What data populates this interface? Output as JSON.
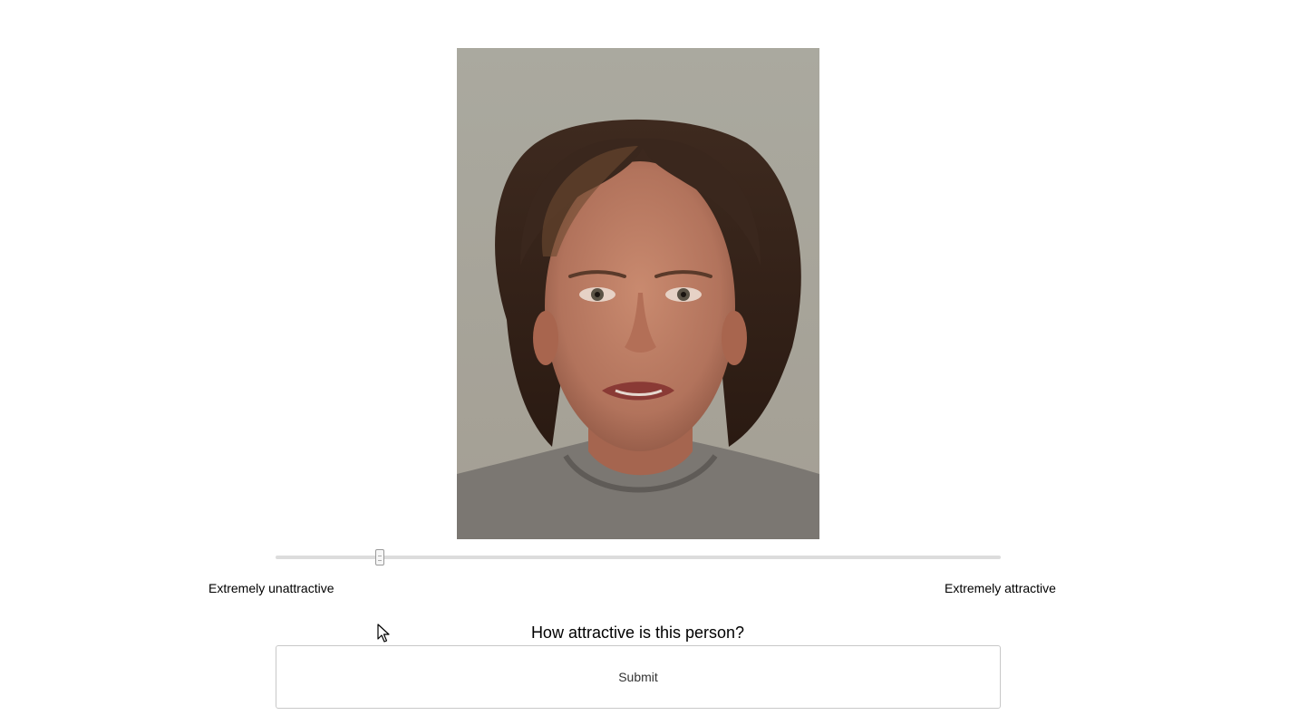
{
  "question": "How attractive is this person?",
  "slider": {
    "min_label": "Extremely unattractive",
    "max_label": "Extremely attractive",
    "value_fraction": 0.144
  },
  "submit_label": "Submit",
  "colors": {
    "track": "#dcdcdc",
    "button_border": "#c8c8c8"
  }
}
